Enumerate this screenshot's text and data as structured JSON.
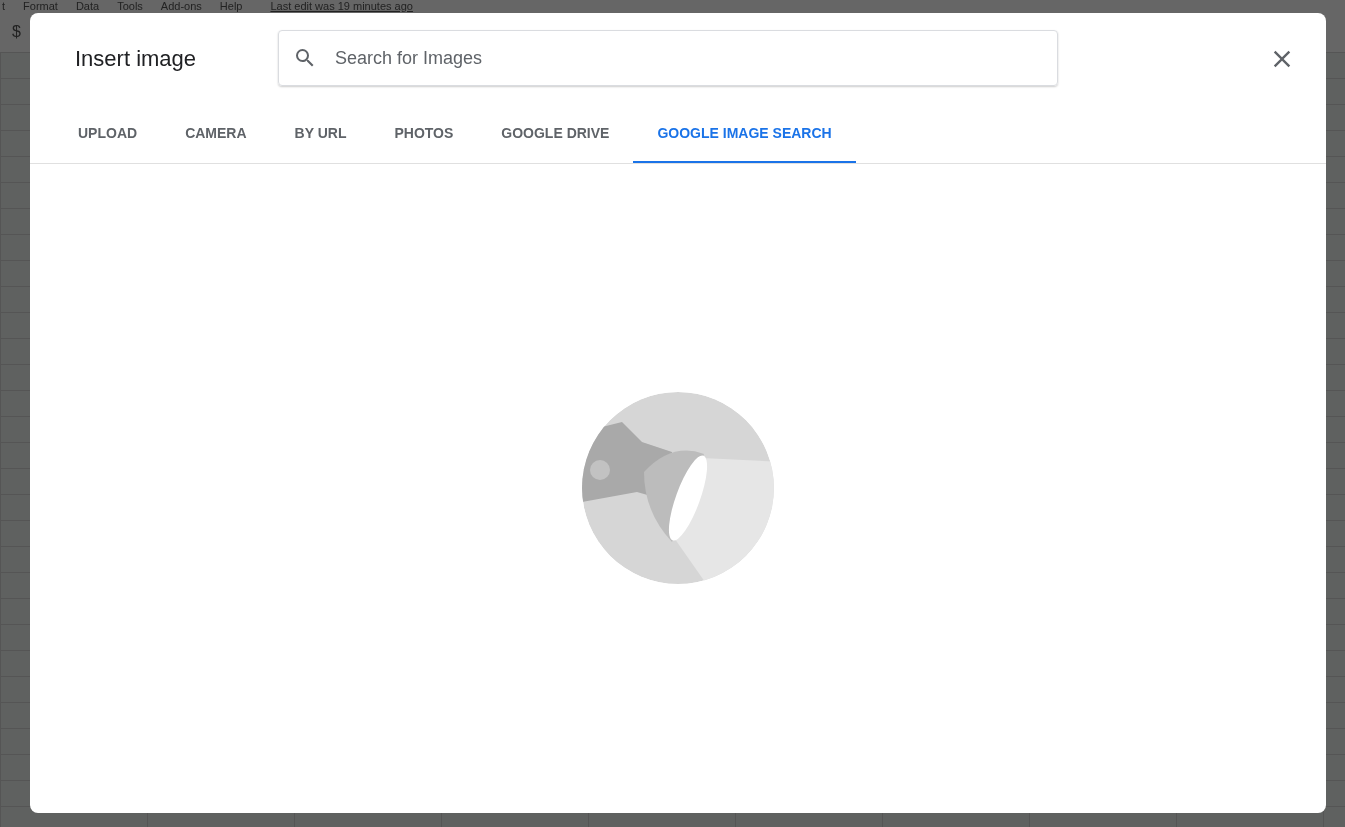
{
  "background_app": {
    "menu": [
      "t",
      "Format",
      "Data",
      "Tools",
      "Add-ons",
      "Help"
    ],
    "last_edit": "Last edit was 19 minutes ago",
    "toolbar_symbol": "$"
  },
  "dialog": {
    "title": "Insert image",
    "search": {
      "placeholder": "Search for Images"
    },
    "tabs": [
      {
        "label": "UPLOAD",
        "selected": false
      },
      {
        "label": "CAMERA",
        "selected": false
      },
      {
        "label": "BY URL",
        "selected": false
      },
      {
        "label": "PHOTOS",
        "selected": false
      },
      {
        "label": "GOOGLE DRIVE",
        "selected": false
      },
      {
        "label": "GOOGLE IMAGE SEARCH",
        "selected": true
      }
    ]
  }
}
